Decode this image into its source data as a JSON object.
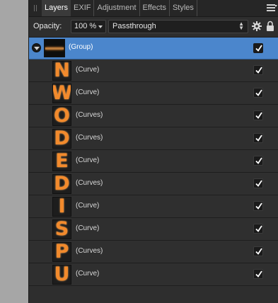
{
  "tabs": [
    {
      "label": "Layers",
      "active": true
    },
    {
      "label": "EXIF",
      "active": false
    },
    {
      "label": "Adjustment",
      "active": false
    },
    {
      "label": "Effects",
      "active": false
    },
    {
      "label": "Styles",
      "active": false
    }
  ],
  "options": {
    "opacity_label": "Opacity:",
    "opacity_value": "100 %",
    "blend_mode": "Passthrough"
  },
  "group": {
    "name": "(Group)",
    "visible": true,
    "expanded": true
  },
  "layers": [
    {
      "letter": "N",
      "name": "(Curve)",
      "visible": true
    },
    {
      "letter": "W",
      "name": "(Curve)",
      "visible": true
    },
    {
      "letter": "O",
      "name": "(Curves)",
      "visible": true
    },
    {
      "letter": "D",
      "name": "(Curves)",
      "visible": true
    },
    {
      "letter": "E",
      "name": "(Curve)",
      "visible": true
    },
    {
      "letter": "D",
      "name": "(Curves)",
      "visible": true
    },
    {
      "letter": "I",
      "name": "(Curve)",
      "visible": true
    },
    {
      "letter": "S",
      "name": "(Curve)",
      "visible": true
    },
    {
      "letter": "P",
      "name": "(Curves)",
      "visible": true
    },
    {
      "letter": "U",
      "name": "(Curve)",
      "visible": true
    }
  ],
  "colors": {
    "selection": "#4b86cc",
    "letter_fill": "#f28a2c",
    "panel_bg": "#2e2e2e"
  }
}
